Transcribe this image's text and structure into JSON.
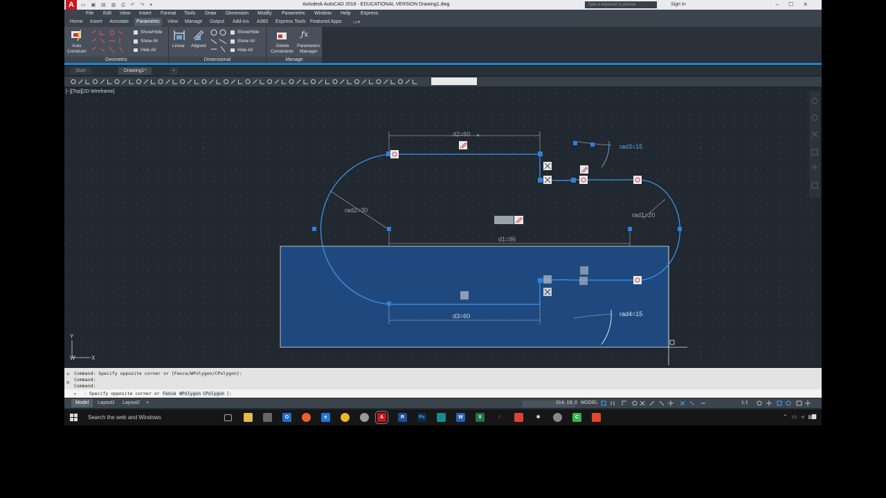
{
  "titlebar": {
    "app_logo": "A",
    "title": "Autodesk AutoCAD 2018 - EDUCATIONAL VERSION    Drawing1.dwg",
    "search_placeholder": "Type a keyword or phrase",
    "sign_in": "Sign In"
  },
  "menu": [
    "File",
    "Edit",
    "View",
    "Insert",
    "Format",
    "Tools",
    "Draw",
    "Dimension",
    "Modify",
    "Parametric",
    "Window",
    "Help",
    "Express"
  ],
  "ribbon_tabs": [
    "Home",
    "Insert",
    "Annotate",
    "Parametric",
    "View",
    "Manage",
    "Output",
    "Add-ins",
    "A360",
    "Express Tools",
    "Featured Apps"
  ],
  "ribbon": {
    "auto_constrain": "Auto\nConstrain",
    "auto_constrain_l1": "Auto",
    "auto_constrain_l2": "Constrain",
    "geo_show_hide": "Show/Hide",
    "geo_show_all": "Show All",
    "geo_hide_all": "Hide All",
    "linear": "Linear",
    "aligned": "Aligned",
    "dim_show_hide": "Show/Hide",
    "dim_show_all": "Show All",
    "dim_hide_all": "Hide All",
    "delete_l1": "Delete",
    "delete_l2": "Constraints",
    "params_l1": "Parameters",
    "params_l2": "Manager",
    "panel_geometric": "Geometric",
    "panel_dimensional": "Dimensional",
    "panel_manage": "Manage"
  },
  "doc_tabs": [
    "Start",
    "Drawing1*"
  ],
  "viewport": {
    "label": "[−][Top][2D Wireframe]",
    "dims": {
      "d1": "d1=96",
      "d2": "d2=60",
      "d3": "d3=60",
      "rad1": "rad1=20",
      "rad2": "rad2=30",
      "rad3": "rad3=15",
      "rad4": "rad4=15"
    },
    "ucs_y": "Y",
    "ucs_x": "X",
    "ucs_w": "W"
  },
  "command": {
    "history": [
      "Command: Specify opposite corner or [Fence/WPolygon/CPolygon]:",
      "Command:",
      "Command:"
    ],
    "prompt": "- Specify opposite corner or [",
    "opt1": "Fence",
    "opt2": "WPolygon",
    "opt3": "CPolygon",
    "prompt_end": "]:"
  },
  "status": {
    "layout_tabs": [
      "Model",
      "Layout1",
      "Layout2"
    ],
    "coords": "314, 19, 0",
    "space": "MODEL",
    "scale": "1:1"
  },
  "taskbar": {
    "search": "Search the web and Windows"
  },
  "colors": {
    "accent": "#1e86c8",
    "selection_fill": "#1f4f8a",
    "geometry": "#3d8fe8",
    "grip": "#2c7fd8",
    "autocad_red": "#c8171d"
  }
}
